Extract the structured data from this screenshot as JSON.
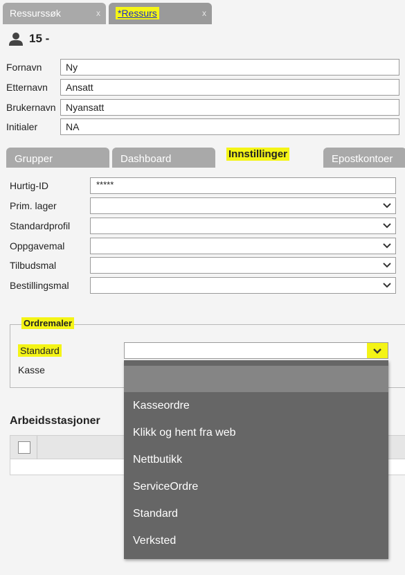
{
  "doc_tabs": [
    {
      "label": "Ressurssøk",
      "close": "x"
    },
    {
      "label": "*Ressurs",
      "close": "x"
    }
  ],
  "resource": {
    "id_text": "15 -"
  },
  "fields": {
    "fornavn": {
      "label": "Fornavn",
      "value": "Ny"
    },
    "etternavn": {
      "label": "Etternavn",
      "value": "Ansatt"
    },
    "brukernavn": {
      "label": "Brukernavn",
      "value": "Nyansatt"
    },
    "initialer": {
      "label": "Initialer",
      "value": "NA"
    }
  },
  "section_tabs": [
    "Grupper",
    "Dashboard",
    "Innstillinger",
    "Epostkontoer"
  ],
  "settings": {
    "hurtig_id": {
      "label": "Hurtig-ID",
      "value": "*****"
    },
    "prim_lager": {
      "label": "Prim. lager",
      "value": ""
    },
    "standardprofil": {
      "label": "Standardprofil",
      "value": ""
    },
    "oppgavemal": {
      "label": "Oppgavemal",
      "value": ""
    },
    "tilbudsmal": {
      "label": "Tilbudsmal",
      "value": ""
    },
    "bestillingsmal": {
      "label": "Bestillingsmal",
      "value": ""
    }
  },
  "ordremaler": {
    "legend": "Ordremaler",
    "standard_label": "Standard",
    "kasse_label": "Kasse"
  },
  "arbeidsstasjoner": {
    "title": "Arbeidsstasjoner"
  },
  "dropdown": {
    "options": [
      "Kasseordre",
      "Klikk og hent fra web",
      "Nettbutikk",
      "ServiceOrdre",
      "Standard",
      "Verksted"
    ]
  },
  "colors": {
    "highlight": "#f4f416",
    "tab_gray": "#a9a9a9",
    "dropdown_bg": "#666666"
  }
}
